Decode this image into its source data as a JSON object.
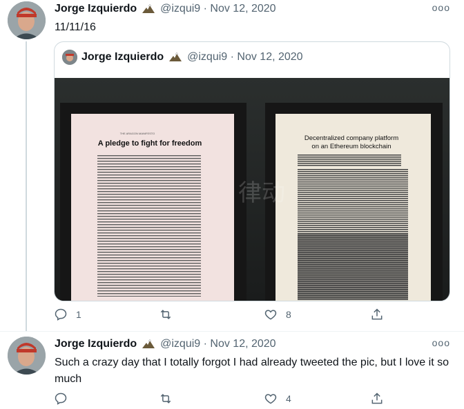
{
  "tweets": [
    {
      "author_name": "Jorge Izquierdo",
      "handle": "@izqui9",
      "date": "Nov 12, 2020",
      "text": "11/11/16",
      "more_label": "ooo",
      "quoted": {
        "author_name": "Jorge Izquierdo",
        "handle": "@izqui9",
        "date": "Nov 12, 2020",
        "image_left_title": "A pledge to fight for freedom",
        "image_left_kicker": "THE ARAGON MANIFESTO",
        "image_right_title": "Decentralized company platform on an Ethereum blockchain"
      },
      "actions": {
        "replies": "1",
        "retweets": "",
        "likes": "8"
      }
    },
    {
      "author_name": "Jorge Izquierdo",
      "handle": "@izqui9",
      "date": "Nov 12, 2020",
      "text": "Such a crazy day that I totally forgot I had already tweeted the pic, but I love it so much",
      "more_label": "ooo",
      "actions": {
        "replies": "",
        "retweets": "",
        "likes": "4"
      }
    }
  ],
  "icons": {
    "reply": "reply-icon",
    "retweet": "retweet-icon",
    "like": "heart-icon",
    "share": "share-icon",
    "badge": "eagle-emoji-icon"
  },
  "colors": {
    "text_primary": "#0f1419",
    "text_secondary": "#536471",
    "border": "#cfd9de"
  }
}
